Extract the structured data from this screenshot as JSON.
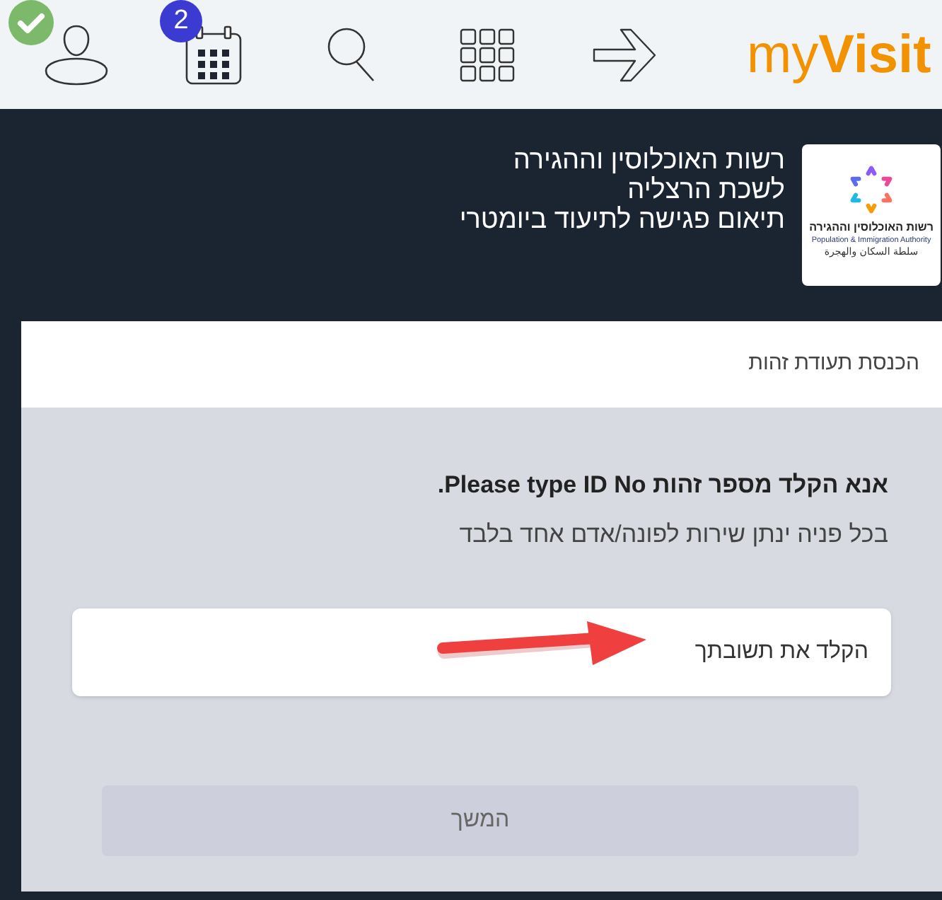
{
  "toolbar": {
    "items": [
      {
        "kind": "profile",
        "verified": true
      },
      {
        "kind": "calendar",
        "badge": "2"
      },
      {
        "kind": "search"
      },
      {
        "kind": "apps"
      },
      {
        "kind": "forward"
      }
    ],
    "logo": "my**Visit**"
  },
  "header": {
    "org_logo": {
      "lines": [
        "רשות האוכלוסין וההגירה",
        "Population & Immigration Authority",
        "سلطة السكان والهجرة"
      ]
    },
    "lines": [
      "רשות האוכלוסין וההגירה",
      "לשכת הרצליה",
      "תיאום פגישה לתיעוד ביומטרי"
    ]
  },
  "form": {
    "step_title": "הכנסת תעודת זהות",
    "question": "אנא הקלד מספר זהות Please type ID No.",
    "note": "בכל פניה ינתן שירות לפונה/אדם אחד בלבד",
    "input": {
      "placeholder": "הקלד את תשובתך"
    },
    "button": {
      "label": "המשך",
      "disabled": true
    }
  }
}
